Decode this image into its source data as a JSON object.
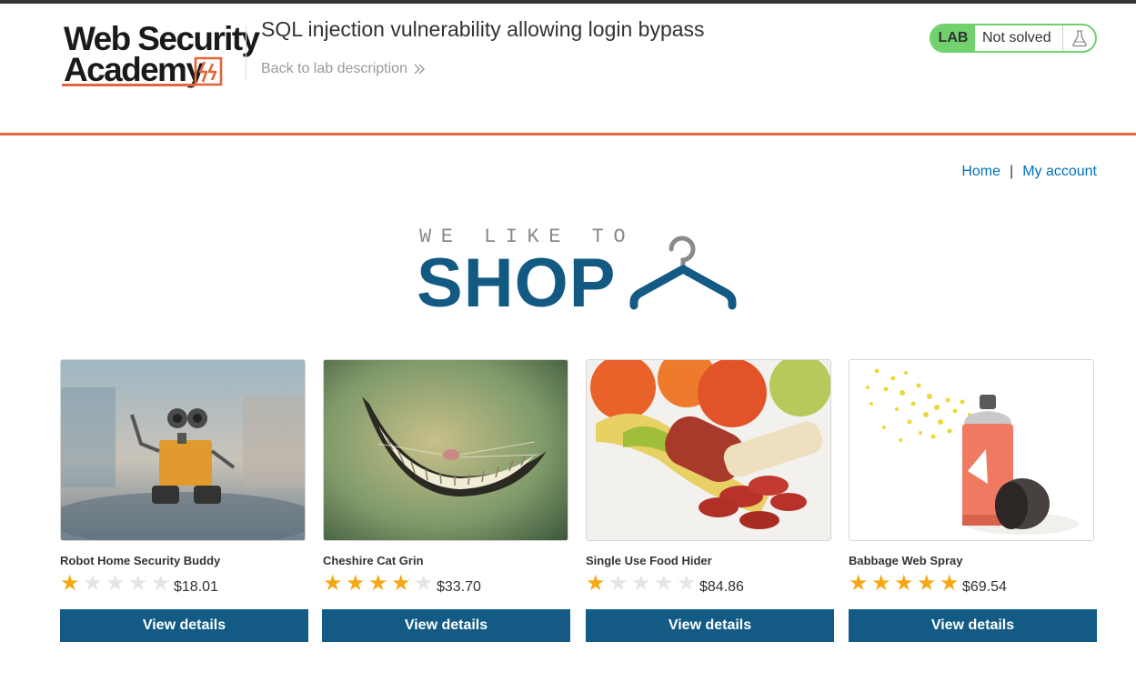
{
  "header": {
    "logo_line1": "Web Security",
    "logo_line2": "Academy",
    "lab_title": "SQL injection vulnerability allowing login bypass",
    "back_link": "Back to lab description",
    "lab_badge": "LAB",
    "lab_status": "Not solved"
  },
  "nav": {
    "home": "Home",
    "separator": "|",
    "my_account": "My account"
  },
  "banner": {
    "small_text": "WE LIKE TO",
    "big_text": "SHOP"
  },
  "products": [
    {
      "name": "Robot Home Security Buddy",
      "rating": 1,
      "price": "$18.01",
      "button": "View details"
    },
    {
      "name": "Cheshire Cat Grin",
      "rating": 4,
      "price": "$33.70",
      "button": "View details"
    },
    {
      "name": "Single Use Food Hider",
      "rating": 1,
      "price": "$84.86",
      "button": "View details"
    },
    {
      "name": "Babbage Web Spray",
      "rating": 5,
      "price": "$69.54",
      "button": "View details"
    }
  ],
  "colors": {
    "accent_orange": "#e5643a",
    "status_green": "#70d16d",
    "button_blue": "#135b84",
    "link_blue": "#0071bc",
    "star_gold": "#f5a814",
    "star_empty": "#e2e6e8"
  },
  "icons": {
    "back": "chevron-double-right-icon",
    "flask": "flask-icon",
    "hanger": "clothes-hanger-icon",
    "star": "star-icon",
    "logo_mark": "lightning-bracket-icon"
  }
}
